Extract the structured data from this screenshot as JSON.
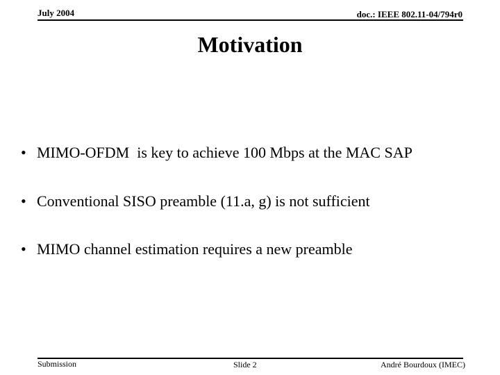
{
  "header": {
    "date": "July 2004",
    "doc_id": "doc.: IEEE 802.11-04/794r0"
  },
  "slide": {
    "title": "Motivation",
    "bullets": [
      {
        "marker": "•",
        "text": "MIMO-OFDM  is key to achieve 100 Mbps at the MAC SAP"
      },
      {
        "marker": "•",
        "text": "Conventional SISO preamble (11.a, g) is not sufficient"
      },
      {
        "marker": "•",
        "text": "MIMO channel estimation requires a new preamble"
      }
    ]
  },
  "footer": {
    "left": "Submission",
    "center": "Slide 2",
    "right": "André Bourdoux (IMEC)"
  }
}
